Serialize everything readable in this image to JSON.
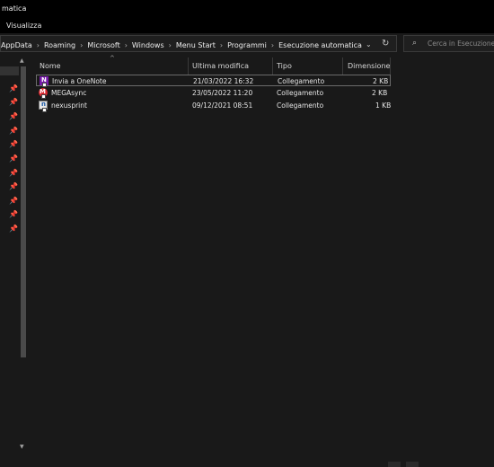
{
  "window": {
    "title": "matica"
  },
  "menu": {
    "items": [
      "Visualizza"
    ]
  },
  "address": {
    "crumbs": [
      "AppData",
      "Roaming",
      "Microsoft",
      "Windows",
      "Menu Start",
      "Programmi",
      "Esecuzione automatica"
    ],
    "separator": "›",
    "dropdown_glyph": "⌄",
    "refresh_glyph": "↻"
  },
  "search": {
    "placeholder": "Cerca in Esecuzione automatica",
    "icon_glyph": "⌕"
  },
  "nav": {
    "pin_glyph": "📌",
    "pin_count": 12,
    "scroll_up": "▲",
    "scroll_down": "▼"
  },
  "columns": {
    "sort_glyph": "^",
    "name": "Nome",
    "modified": "Ultima modifica",
    "type": "Tipo",
    "size": "Dimensione"
  },
  "files": [
    {
      "name": "Invia a OneNote",
      "modified": "21/03/2022 16:32",
      "type": "Collegamento",
      "size": "2 KB",
      "icon": "onenote-icon",
      "selected": true
    },
    {
      "name": "MEGAsync",
      "modified": "23/05/2022 11:20",
      "type": "Collegamento",
      "size": "2 KB",
      "icon": "mega-icon",
      "selected": false
    },
    {
      "name": "nexusprint",
      "modified": "09/12/2021 08:51",
      "type": "Collegamento",
      "size": "1 KB",
      "icon": "nexus-icon",
      "selected": false
    }
  ],
  "colors": {
    "background": "#191919",
    "titlebar": "#000000",
    "text": "#e8e8e8",
    "border": "#3a3a3a"
  }
}
